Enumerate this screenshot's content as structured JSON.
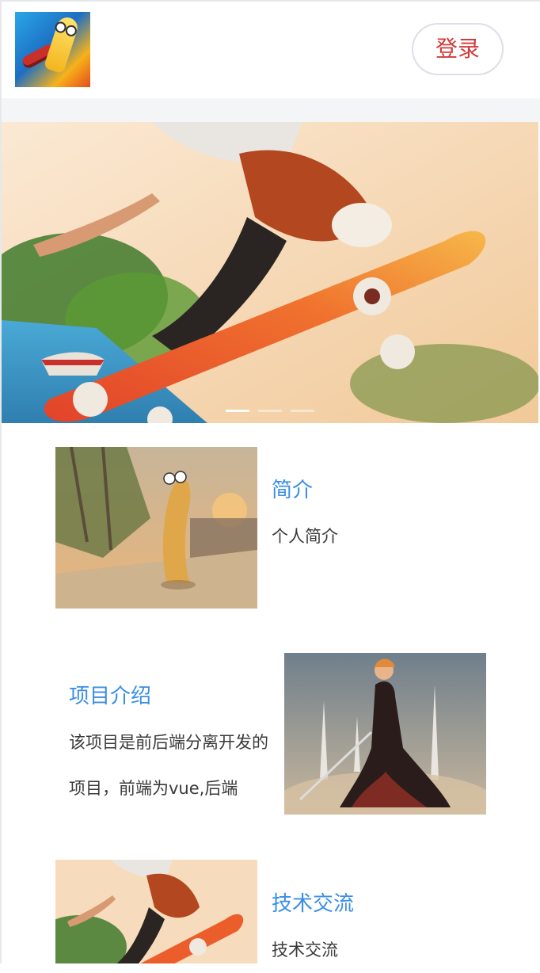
{
  "header": {
    "logo_icon": "turbo-snail-logo-icon",
    "login_label": "登录"
  },
  "banner": {
    "image_icon": "skateboarder-banner-image",
    "slides": 3,
    "active_slide": 1
  },
  "sections": [
    {
      "title": "简介",
      "description": "个人简介",
      "image_icon": "snail-character-image"
    },
    {
      "title": "项目介绍",
      "description": "该项目是前后端分离开发的项目，前端为vue,后端",
      "image_icon": "anime-swordsman-image"
    },
    {
      "title": "技术交流",
      "description": "技术交流",
      "image_icon": "skateboarder-image"
    }
  ],
  "colors": {
    "accent_blue": "#3a8ee6",
    "login_red": "#d23a3a",
    "band_gray": "#f4f5f7"
  }
}
